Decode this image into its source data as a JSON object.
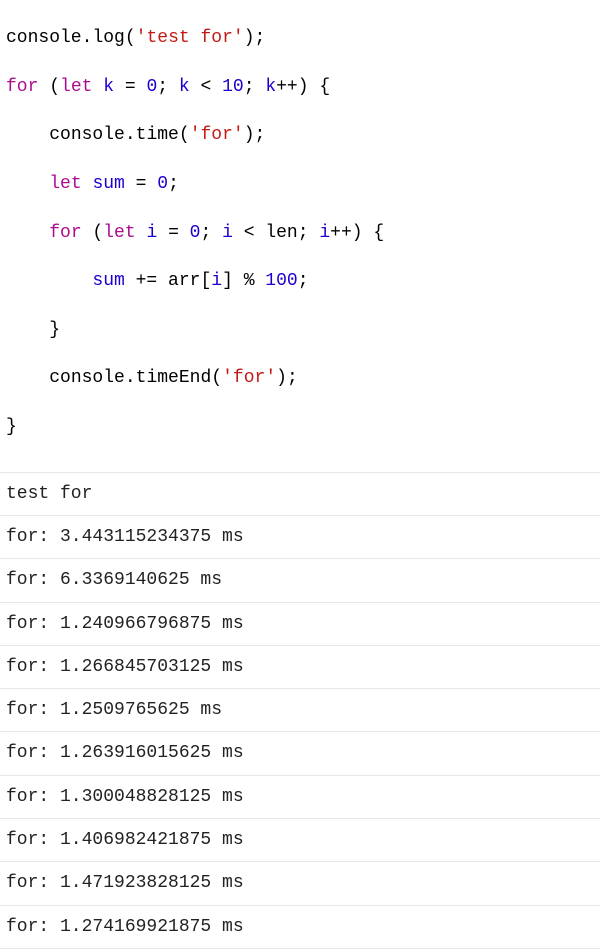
{
  "code": {
    "line1": {
      "obj": "console",
      "dot": ".",
      "method": "log",
      "open": "(",
      "q1": "'",
      "str": "test for",
      "q2": "'",
      "close": ")",
      "semi": ";"
    },
    "line2": {
      "kw1": "for",
      "open": " (",
      "kw2": "let",
      "sp1": " ",
      "var1": "k",
      "eq": " = ",
      "num1": "0",
      "semi1": "; ",
      "var2": "k",
      "lt": " < ",
      "num2": "10",
      "semi2": "; ",
      "var3": "k",
      "inc": "++",
      "close": ") ",
      "brace": "{"
    },
    "line3": {
      "indent": "    ",
      "obj": "console",
      "dot": ".",
      "method": "time",
      "open": "(",
      "q1": "'",
      "str": "for",
      "q2": "'",
      "close": ")",
      "semi": ";"
    },
    "line4": {
      "indent": "    ",
      "kw": "let",
      "sp": " ",
      "var": "sum",
      "eq": " = ",
      "num": "0",
      "semi": ";"
    },
    "line5": {
      "indent": "    ",
      "kw1": "for",
      "open": " (",
      "kw2": "let",
      "sp1": " ",
      "var1": "i",
      "eq": " = ",
      "num1": "0",
      "semi1": "; ",
      "var2": "i",
      "lt": " < ",
      "ident": "len",
      "semi2": "; ",
      "var3": "i",
      "inc": "++",
      "close": ") ",
      "brace": "{"
    },
    "line6": {
      "indent": "        ",
      "var1": "sum",
      "op": " += ",
      "ident": "arr",
      "br1": "[",
      "var2": "i",
      "br2": "]",
      "mod": " % ",
      "num": "100",
      "semi": ";"
    },
    "line7": {
      "indent": "    ",
      "brace": "}"
    },
    "line8": {
      "indent": "    ",
      "obj": "console",
      "dot": ".",
      "method": "timeEnd",
      "open": "(",
      "q1": "'",
      "str": "for",
      "q2": "'",
      "close": ")",
      "semi": ";"
    },
    "line9": {
      "brace": "}"
    }
  },
  "output": {
    "rows": [
      "test for",
      "for: 3.443115234375 ms",
      "for: 6.3369140625 ms",
      "for: 1.240966796875 ms",
      "for: 1.266845703125 ms",
      "for: 1.2509765625 ms",
      "for: 1.263916015625 ms",
      "for: 1.300048828125 ms",
      "for: 1.406982421875 ms",
      "for: 1.471923828125 ms",
      "for: 1.274169921875 ms"
    ]
  }
}
